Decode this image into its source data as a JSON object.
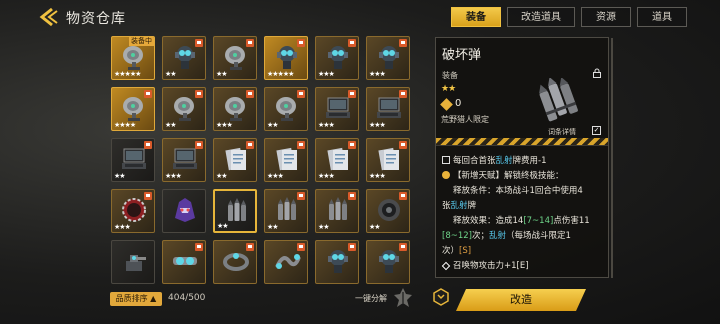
{
  "header": {
    "title": "物资仓库",
    "tabs": [
      {
        "label": "装备",
        "active": true
      },
      {
        "label": "改造道具",
        "active": false
      },
      {
        "label": "资源",
        "active": false
      },
      {
        "label": "道具",
        "active": false
      }
    ]
  },
  "inventory": {
    "equipped_badge": "装备中",
    "count": "404/500",
    "sort_label": "品质排序",
    "dismantle_label": "一键分解",
    "items": [
      {
        "icon": "radar-dish-icon",
        "stars": "★★★★★",
        "frame": "gold",
        "equipped": true,
        "locked": true
      },
      {
        "icon": "drone-icon",
        "stars": "★★",
        "frame": "normal",
        "locked": true
      },
      {
        "icon": "radar-dish-icon",
        "stars": "★★",
        "frame": "normal",
        "locked": true
      },
      {
        "icon": "drone-icon",
        "stars": "★★★★★",
        "frame": "gold",
        "locked": true
      },
      {
        "icon": "drone-icon",
        "stars": "★★★",
        "frame": "normal",
        "locked": true
      },
      {
        "icon": "drone-icon",
        "stars": "★★★",
        "frame": "normal",
        "locked": true
      },
      {
        "icon": "radar-dish-icon",
        "stars": "★★★★",
        "frame": "gold",
        "locked": true
      },
      {
        "icon": "radar-dish-icon",
        "stars": "★★",
        "frame": "normal",
        "locked": true
      },
      {
        "icon": "radar-dish-icon",
        "stars": "★★★",
        "frame": "normal",
        "locked": true
      },
      {
        "icon": "radar-dish-icon",
        "stars": "★★",
        "frame": "normal",
        "locked": true
      },
      {
        "icon": "laptop-icon",
        "stars": "★★★",
        "frame": "normal",
        "locked": true
      },
      {
        "icon": "laptop-icon",
        "stars": "★★★",
        "frame": "normal",
        "locked": true
      },
      {
        "icon": "laptop-icon",
        "stars": "★★",
        "frame": "dark",
        "locked": true
      },
      {
        "icon": "laptop-icon",
        "stars": "★★★",
        "frame": "normal",
        "locked": true
      },
      {
        "icon": "document-icon",
        "stars": "★★",
        "frame": "normal",
        "locked": true
      },
      {
        "icon": "document-icon",
        "stars": "★★★",
        "frame": "normal",
        "locked": true
      },
      {
        "icon": "document-icon",
        "stars": "★★★",
        "frame": "normal",
        "locked": true
      },
      {
        "icon": "document-icon",
        "stars": "★★★",
        "frame": "normal",
        "locked": true
      },
      {
        "icon": "gear-ring-icon",
        "stars": "★★★",
        "frame": "normal",
        "locked": true
      },
      {
        "icon": "mech-head-icon",
        "stars": "",
        "frame": "dark",
        "locked": false
      },
      {
        "icon": "ammo-icon",
        "stars": "★★",
        "frame": "dark",
        "locked": false,
        "selected": true
      },
      {
        "icon": "ammo-icon",
        "stars": "★★",
        "frame": "normal",
        "locked": true
      },
      {
        "icon": "ammo-icon",
        "stars": "★★",
        "frame": "normal",
        "locked": true
      },
      {
        "icon": "lens-icon",
        "stars": "★★",
        "frame": "normal",
        "locked": true
      },
      {
        "icon": "turret-icon",
        "stars": "",
        "frame": "dark",
        "locked": false
      },
      {
        "icon": "goggles-icon",
        "stars": "",
        "frame": "normal",
        "locked": true
      },
      {
        "icon": "bracelet-icon",
        "stars": "",
        "frame": "normal",
        "locked": true
      },
      {
        "icon": "cable-icon",
        "stars": "",
        "frame": "normal",
        "locked": true
      },
      {
        "icon": "drone-icon",
        "stars": "",
        "frame": "normal",
        "locked": true
      },
      {
        "icon": "drone-icon",
        "stars": "",
        "frame": "normal",
        "locked": true
      }
    ]
  },
  "detail": {
    "name": "破坏弹",
    "category": "装备",
    "stars": "★★",
    "cost": "0",
    "restriction": "荒野猎人限定",
    "details_label": "词条详情",
    "details_checked": true,
    "line1_a": "每回合首张",
    "line1_b": "乱射",
    "line1_c": "牌费用-1",
    "line2": "【新增天赋】解锁终极技能：",
    "line3": "释放条件：本场战斗1回合中使用4",
    "line4_a": "张",
    "line4_b": "乱射",
    "line4_c": "牌",
    "line5_a": "释放效果：造成14",
    "line5_b": "[7~14]",
    "line5_c": "点伤害11",
    "line6_a": "[8~12]",
    "line6_b": "次；",
    "line6_c": "乱射",
    "line6_d": "（每场战斗限定1",
    "line7_a": "次）",
    "line7_b": "[S]",
    "line8": "召唤物攻击力+1[E]"
  },
  "actions": {
    "modify_label": "改造"
  },
  "colors": {
    "accent": "#f0c140",
    "highlight_blue": "#57c7ea",
    "highlight_green": "#6fd58a"
  }
}
